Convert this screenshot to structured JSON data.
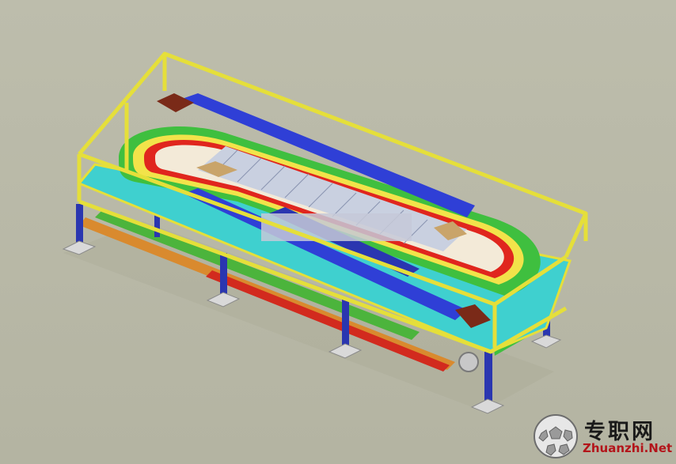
{
  "scene": {
    "subject": "3D CAD model of an oval assembly conveyor line inside a yellow guard frame",
    "colors": {
      "background": "#b9b9a8",
      "frame_yellow": "#e5df3a",
      "deck_cyan": "#3fd0cf",
      "belt_blue": "#2f3fd6",
      "curve_green": "#3fbf3f",
      "curve_yellow": "#f2e34a",
      "curve_red": "#e0261e",
      "legs_blue": "#2a36b0",
      "beam_orange": "#d98a2e",
      "beam_red": "#d22a1e",
      "drive_box": "#7a2a18"
    }
  },
  "watermark": {
    "cn_text": "专职网",
    "en_text": "Zhuanzhi.Net"
  }
}
